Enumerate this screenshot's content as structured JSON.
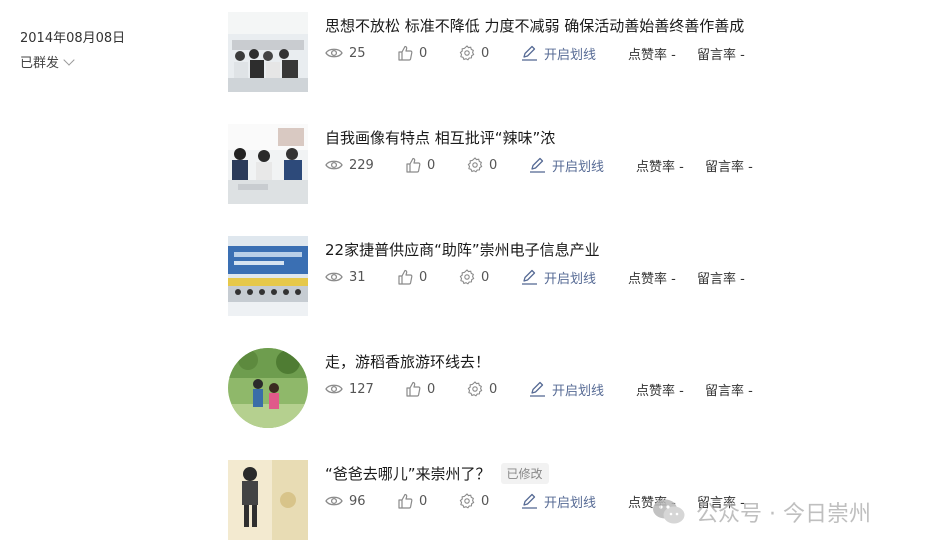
{
  "date": "2014年08月08日",
  "status": "已群发",
  "items": [
    {
      "title": "思想不放松 标准不降低 力度不减弱  确保活动善始善终善作善成",
      "views": "25",
      "likes": "0",
      "shares": "0",
      "highlight": "开启划线",
      "like_rate": "点赞率 -",
      "comment_rate": "留言率 -",
      "badge": ""
    },
    {
      "title": "自我画像有特点   相互批评“辣味”浓",
      "views": "229",
      "likes": "0",
      "shares": "0",
      "highlight": "开启划线",
      "like_rate": "点赞率 -",
      "comment_rate": "留言率 -",
      "badge": ""
    },
    {
      "title": "22家捷普供应商“助阵”崇州电子信息产业",
      "views": "31",
      "likes": "0",
      "shares": "0",
      "highlight": "开启划线",
      "like_rate": "点赞率 -",
      "comment_rate": "留言率 -",
      "badge": ""
    },
    {
      "title": "走，游稻香旅游环线去！",
      "views": "127",
      "likes": "0",
      "shares": "0",
      "highlight": "开启划线",
      "like_rate": "点赞率 -",
      "comment_rate": "留言率 -",
      "badge": ""
    },
    {
      "title": "“爸爸去哪儿”来崇州了？",
      "views": "96",
      "likes": "0",
      "shares": "0",
      "highlight": "开启划线",
      "like_rate": "点赞率 -",
      "comment_rate": "留言率 -",
      "badge": "已修改"
    }
  ],
  "watermark": "公众号 · 今日崇州",
  "colors": {
    "link": "#576b95",
    "icon": "#8a8a8a"
  }
}
